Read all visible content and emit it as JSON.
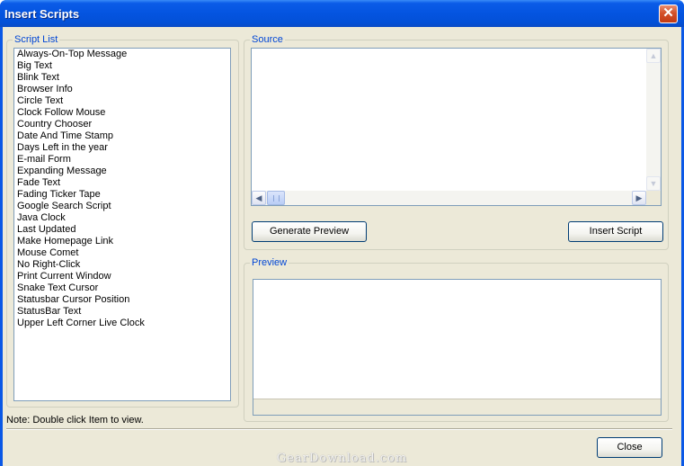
{
  "window": {
    "title": "Insert Scripts"
  },
  "script_list": {
    "legend": "Script List",
    "items": [
      "Always-On-Top Message",
      "Big Text",
      "Blink Text",
      "Browser Info",
      "Circle Text",
      "Clock Follow Mouse",
      "Country Chooser",
      "Date And Time Stamp",
      "Days Left in the year",
      "E-mail Form",
      "Expanding Message",
      "Fade Text",
      "Fading Ticker Tape",
      "Google Search Script",
      "Java Clock",
      "Last Updated",
      "Make Homepage Link",
      "Mouse Comet",
      "No Right-Click",
      "Print Current Window",
      "Snake Text Cursor",
      "Statusbar Cursor Position",
      "StatusBar Text",
      "Upper Left Corner Live Clock"
    ]
  },
  "source": {
    "legend": "Source",
    "value": ""
  },
  "buttons": {
    "generate_preview": "Generate Preview",
    "insert_script": "Insert Script",
    "close": "Close"
  },
  "preview": {
    "legend": "Preview"
  },
  "note": "Note: Double click Item to view.",
  "watermark": "GearDownload.com",
  "icons": {
    "close": "close-icon",
    "scroll_up": "arrow-up-icon",
    "scroll_down": "arrow-down-icon",
    "scroll_left": "arrow-left-icon",
    "scroll_right": "arrow-right-icon"
  }
}
